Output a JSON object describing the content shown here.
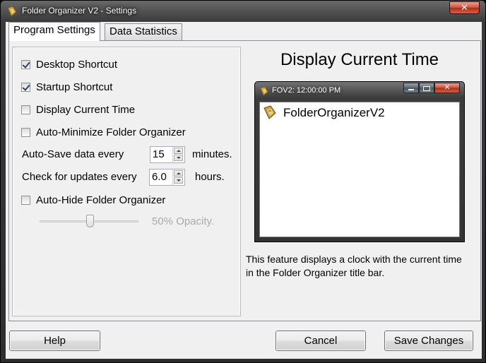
{
  "window": {
    "title": "Folder Organizer V2 - Settings",
    "close_glyph": "✕"
  },
  "tabs": [
    {
      "label": "Program Settings",
      "active": true
    },
    {
      "label": "Data Statistics",
      "active": false
    }
  ],
  "settings": {
    "desktop_shortcut": {
      "label": "Desktop Shortcut",
      "checked": true
    },
    "startup_shortcut": {
      "label": "Startup Shortcut",
      "checked": true
    },
    "display_current_time": {
      "label": "Display Current Time",
      "checked": false
    },
    "auto_minimize": {
      "label": "Auto-Minimize Folder Organizer",
      "checked": false
    },
    "auto_save": {
      "label_before": "Auto-Save data every",
      "value": "15",
      "label_after": "minutes."
    },
    "check_updates": {
      "label_before": "Check for updates every",
      "value": "6.0",
      "label_after": "hours."
    },
    "auto_hide": {
      "label": "Auto-Hide Folder Organizer",
      "checked": false
    },
    "opacity": {
      "label": "50% Opacity.",
      "value_percent": 50
    }
  },
  "preview": {
    "heading": "Display Current Time",
    "window_title": "FOV2: 12:00:00 PM",
    "app_name": "FolderOrganizerV2",
    "close_glyph": "✕",
    "description": "This feature displays a clock with the current time in the Folder Organizer title bar."
  },
  "buttons": {
    "help": "Help",
    "cancel": "Cancel",
    "save": "Save Changes"
  },
  "colors": {
    "accent_close": "#c8523a",
    "disabled_text": "#a9a9a9"
  }
}
